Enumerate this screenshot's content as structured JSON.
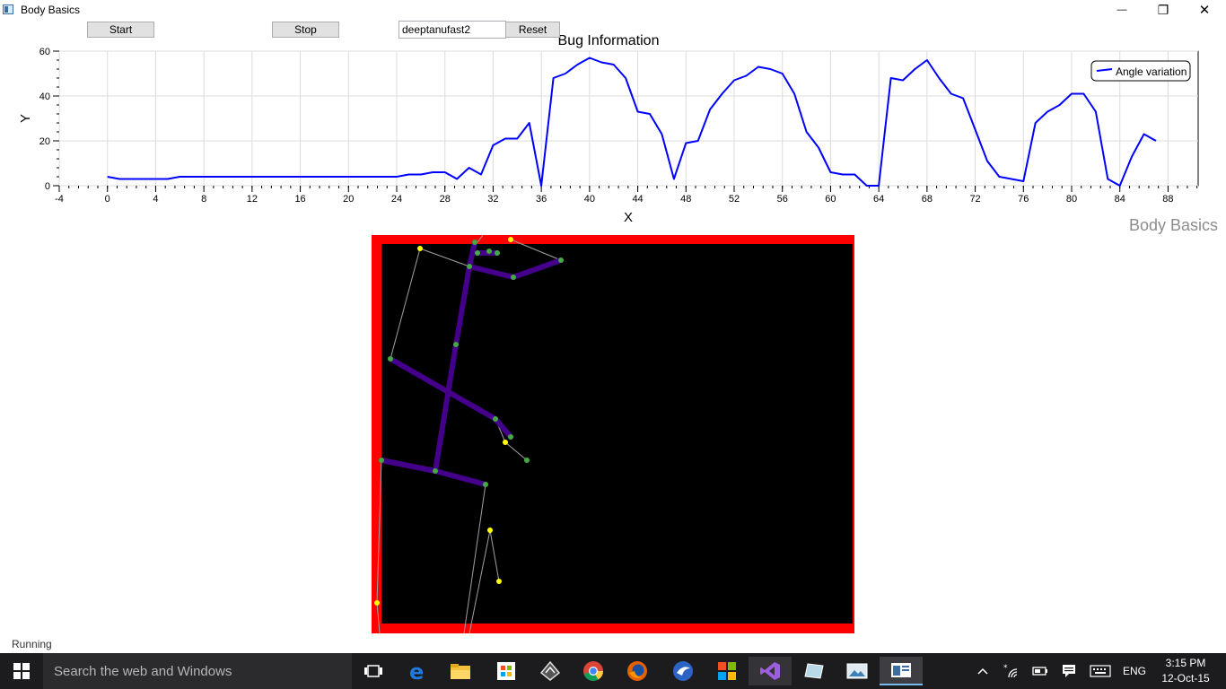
{
  "window": {
    "title": "Body Basics",
    "minimize_glyph": "—",
    "maximize_glyph": "❐",
    "close_glyph": "✕"
  },
  "toolbar": {
    "start_label": "Start",
    "stop_label": "Stop",
    "name_value": "deeptanufast2",
    "reset_label": "Reset"
  },
  "chart_data": {
    "type": "line",
    "title": "Bug Information",
    "xlabel": "X",
    "ylabel": "Y",
    "xlim": [
      -4,
      90.5
    ],
    "ylim": [
      0,
      60
    ],
    "x_ticks": [
      -4,
      0,
      4,
      8,
      12,
      16,
      20,
      24,
      28,
      32,
      36,
      40,
      44,
      48,
      52,
      56,
      60,
      64,
      68,
      72,
      76,
      80,
      84,
      88
    ],
    "y_ticks": [
      0,
      20,
      40,
      60
    ],
    "grid": true,
    "legend_position": "top-right",
    "series": [
      {
        "name": "Angle variation",
        "color": "#0000ff",
        "points": [
          [
            0,
            4
          ],
          [
            1,
            3
          ],
          [
            2,
            3
          ],
          [
            3,
            3
          ],
          [
            4,
            3
          ],
          [
            5,
            3
          ],
          [
            6,
            4
          ],
          [
            7,
            4
          ],
          [
            8,
            4
          ],
          [
            9,
            4
          ],
          [
            10,
            4
          ],
          [
            11,
            4
          ],
          [
            12,
            4
          ],
          [
            13,
            4
          ],
          [
            14,
            4
          ],
          [
            15,
            4
          ],
          [
            16,
            4
          ],
          [
            17,
            4
          ],
          [
            18,
            4
          ],
          [
            19,
            4
          ],
          [
            20,
            4
          ],
          [
            21,
            4
          ],
          [
            22,
            4
          ],
          [
            23,
            4
          ],
          [
            24,
            4
          ],
          [
            25,
            5
          ],
          [
            26,
            5
          ],
          [
            27,
            6
          ],
          [
            28,
            6
          ],
          [
            29,
            3
          ],
          [
            30,
            8
          ],
          [
            31,
            5
          ],
          [
            32,
            18
          ],
          [
            33,
            21
          ],
          [
            34,
            21
          ],
          [
            35,
            28
          ],
          [
            36,
            0
          ],
          [
            37,
            48
          ],
          [
            38,
            50
          ],
          [
            39,
            54
          ],
          [
            40,
            57
          ],
          [
            41,
            55
          ],
          [
            42,
            54
          ],
          [
            43,
            48
          ],
          [
            44,
            33
          ],
          [
            45,
            32
          ],
          [
            46,
            23
          ],
          [
            47,
            3
          ],
          [
            48,
            19
          ],
          [
            49,
            20
          ],
          [
            50,
            34
          ],
          [
            51,
            41
          ],
          [
            52,
            47
          ],
          [
            53,
            49
          ],
          [
            54,
            53
          ],
          [
            55,
            52
          ],
          [
            56,
            50
          ],
          [
            57,
            41
          ],
          [
            58,
            24
          ],
          [
            59,
            17
          ],
          [
            60,
            6
          ],
          [
            61,
            5
          ],
          [
            62,
            5
          ],
          [
            63,
            0
          ],
          [
            64,
            0
          ],
          [
            65,
            48
          ],
          [
            66,
            47
          ],
          [
            67,
            52
          ],
          [
            68,
            56
          ],
          [
            69,
            48
          ],
          [
            70,
            41
          ],
          [
            71,
            39
          ],
          [
            72,
            25
          ],
          [
            73,
            11
          ],
          [
            74,
            4
          ],
          [
            75,
            3
          ],
          [
            76,
            2
          ],
          [
            77,
            28
          ],
          [
            78,
            33
          ],
          [
            79,
            36
          ],
          [
            80,
            41
          ],
          [
            81,
            41
          ],
          [
            82,
            33
          ],
          [
            83,
            3
          ],
          [
            84,
            0
          ],
          [
            85,
            13
          ],
          [
            86,
            23
          ],
          [
            87,
            20
          ]
        ]
      }
    ]
  },
  "app_label": "Body Basics",
  "status": "Running",
  "colors": {
    "skeleton_bone": "#44008b",
    "joint_tracked": "#44aa44",
    "joint_inferred": "#ffff00",
    "bone_inferred": "#a0a0a0",
    "clip_edge": "#ff0000",
    "canvas_bg": "#000000"
  },
  "taskbar": {
    "search_placeholder": "Search the web and Windows",
    "apps": [
      "task-view-icon",
      "edge-browser-icon",
      "file-explorer-icon",
      "store-icon",
      "inkscape-icon",
      "chrome-icon",
      "firefox-icon",
      "eagle-app-icon",
      "office-icon",
      "visual-studio-icon",
      "tablet-app-icon",
      "photo-app-icon",
      "body-basics-app-icon"
    ],
    "language": "ENG",
    "time": "3:15 PM",
    "date": "12-Oct-15"
  }
}
